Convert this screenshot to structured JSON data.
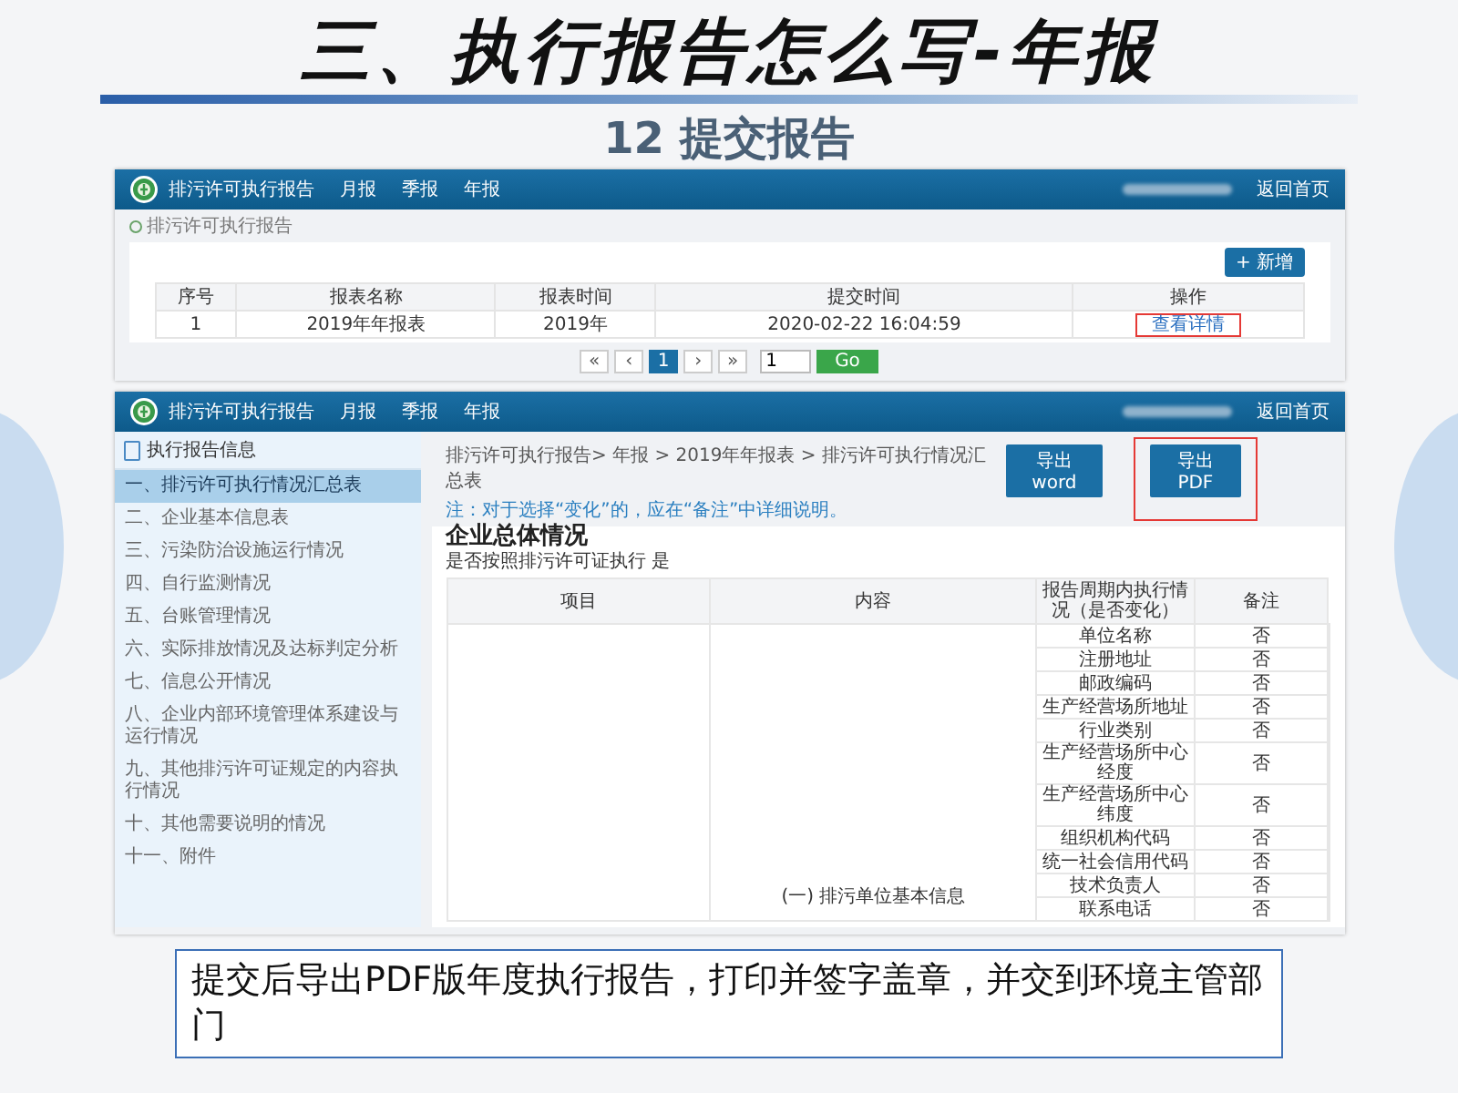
{
  "slide": {
    "title": "三、执行报告怎么写-年报",
    "subtitle": "12 提交报告",
    "caption": "提交后导出PDF版年度执行报告，打印并签字盖章，并交到环境主管部门"
  },
  "list_screen": {
    "app_title": "排污许可执行报告",
    "nav": [
      "月报",
      "季报",
      "年报"
    ],
    "home_link": "返回首页",
    "breadcrumb": "排污许可执行报告",
    "add_button": "+ 新增",
    "columns": [
      "序号",
      "报表名称",
      "报表时间",
      "提交时间",
      "操作"
    ],
    "rows": [
      {
        "cells": [
          "1",
          "2019年年报表",
          "2019年",
          "2020-02-22 16:04:59"
        ],
        "action": "查看详情",
        "highlighted": true
      }
    ],
    "pages": [
      {
        "label": "«",
        "selected": false
      },
      {
        "label": "‹",
        "selected": false
      },
      {
        "label": "1",
        "selected": true
      },
      {
        "label": "›",
        "selected": false
      },
      {
        "label": "»",
        "selected": false
      }
    ],
    "page_input": "1",
    "go_button": "Go"
  },
  "detail_screen": {
    "app_title": "排污许可执行报告",
    "nav": [
      "月报",
      "季报",
      "年报"
    ],
    "home_link": "返回首页",
    "sidebar": {
      "header": "执行报告信息",
      "items": [
        {
          "label": "一、排污许可执行情况汇总表",
          "selected": true
        },
        {
          "label": "二、企业基本信息表",
          "selected": false
        },
        {
          "label": "三、污染防治设施运行情况",
          "selected": false
        },
        {
          "label": "四、自行监测情况",
          "selected": false
        },
        {
          "label": "五、台账管理情况",
          "selected": false
        },
        {
          "label": "六、实际排放情况及达标判定分析",
          "selected": false
        },
        {
          "label": "七、信息公开情况",
          "selected": false
        },
        {
          "label": "八、企业内部环境管理体系建设与运行情况",
          "selected": false
        },
        {
          "label": "九、其他排污许可证规定的内容执行情况",
          "selected": false
        },
        {
          "label": "十、其他需要说明的情况",
          "selected": false
        },
        {
          "label": "十一、附件",
          "selected": false
        }
      ]
    },
    "breadcrumb": "排污许可执行报告> 年报 > 2019年年报表 > 排污许可执行情况汇总表",
    "buttons": [
      {
        "label": "导出word",
        "highlighted": false
      },
      {
        "label": "导出PDF",
        "highlighted": true
      }
    ],
    "note": "注：对于选择“变化”的，应在“备注”中详细说明。",
    "section_title": "企业总体情况",
    "question": "是否按照排污许可证执行 是",
    "columns": [
      "项目",
      "内容",
      "报告周期内执行情况（是否变化）",
      "备注"
    ],
    "group": "(一) 排污单位基本信息",
    "rows": [
      {
        "content": "单位名称",
        "status": "否"
      },
      {
        "content": "注册地址",
        "status": "否"
      },
      {
        "content": "邮政编码",
        "status": "否"
      },
      {
        "content": "生产经营场所地址",
        "status": "否"
      },
      {
        "content": "行业类别",
        "status": "否"
      },
      {
        "content": "生产经营场所中心经度",
        "status": "否"
      },
      {
        "content": "生产经营场所中心纬度",
        "status": "否"
      },
      {
        "content": "组织机构代码",
        "status": "否"
      },
      {
        "content": "统一社会信用代码",
        "status": "否"
      },
      {
        "content": "技术负责人",
        "status": "否"
      },
      {
        "content": "联系电话",
        "status": "否"
      }
    ]
  }
}
